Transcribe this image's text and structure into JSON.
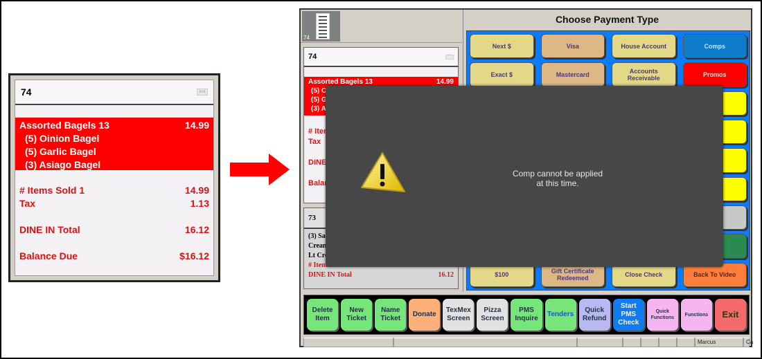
{
  "zoomed_ticket": {
    "ticket_number": "74",
    "header_button": "Exit",
    "line_item": {
      "name": "Assorted Bagels 13",
      "price": "14.99"
    },
    "modifiers": [
      "(5)  Oinion Bagel",
      "(5)  Garlic Bagel",
      "(3)  Asiago Bagel"
    ],
    "totals": {
      "items_sold_label": "# Items Sold 1",
      "items_sold_value": "14.99",
      "tax_label": "Tax",
      "tax_value": "1.13",
      "total_label": "DINE IN Total",
      "total_value": "16.12",
      "balance_label": "Balance Due",
      "balance_value": "$16.12"
    }
  },
  "pos": {
    "thumbnail": {
      "ticket_number": "74"
    },
    "ticket1": {
      "ticket_number": "74",
      "line_item": {
        "name": "Assorted Bagels 13",
        "price": "14.99"
      },
      "modifiers": [
        "(5)  O",
        "(5)  G",
        "(3)  A"
      ],
      "items_label": "# Item",
      "tax_label": "Tax",
      "total_label": "DINE",
      "balance_label": "Balan"
    },
    "ticket2": {
      "ticket_number": "73",
      "lines": [
        "(3) Sal",
        "Crean",
        "Lt Cre"
      ],
      "items_label": "# Items",
      "total_label": "DINE IN Total",
      "total_value": "16.12"
    },
    "payment": {
      "title": "Choose Payment Type",
      "buttons": [
        {
          "label": "Next $",
          "color": "yellow"
        },
        {
          "label": "Visa",
          "color": "tan"
        },
        {
          "label": "House Account",
          "color": "yellow"
        },
        {
          "label": "Comps",
          "color": "blue"
        },
        {
          "label": "Exact $",
          "color": "yellow"
        },
        {
          "label": "Mastercard",
          "color": "tan"
        },
        {
          "label": "Accounts Receivable",
          "color": "yellow"
        },
        {
          "label": "Promos",
          "color": "red"
        },
        {
          "label": "$100",
          "color": "yellow"
        },
        {
          "label": "Gift Certificate Redeemed",
          "color": "tan"
        },
        {
          "label": "Close Check",
          "color": "yellow"
        },
        {
          "label": "Back To Video",
          "color": "orange"
        }
      ]
    },
    "function_bar": [
      {
        "label": "Delete Item"
      },
      {
        "label": "New Ticket"
      },
      {
        "label": "Name Ticket"
      },
      {
        "label": "Donate"
      },
      {
        "label": "TexMex Screen"
      },
      {
        "label": "Pizza Screen"
      },
      {
        "label": "PMS Inquire"
      },
      {
        "label": "Tenders"
      },
      {
        "label": "Quick Refund"
      },
      {
        "label": "Start PMS Check"
      },
      {
        "label": "Quick Functions"
      },
      {
        "label": "Functions"
      },
      {
        "label": "Exit"
      }
    ],
    "status_bar": {
      "user": "Marcus",
      "trailing": "Ca"
    }
  },
  "dialog": {
    "icon": "warning-icon",
    "message_line1": "Comp cannot be applied",
    "message_line2": "at this time."
  },
  "colors": {
    "ticket_highlight": "#ff0000",
    "payment_background": "#0a7cff",
    "dialog_background": "#474747",
    "arrow": "#ff0000"
  }
}
